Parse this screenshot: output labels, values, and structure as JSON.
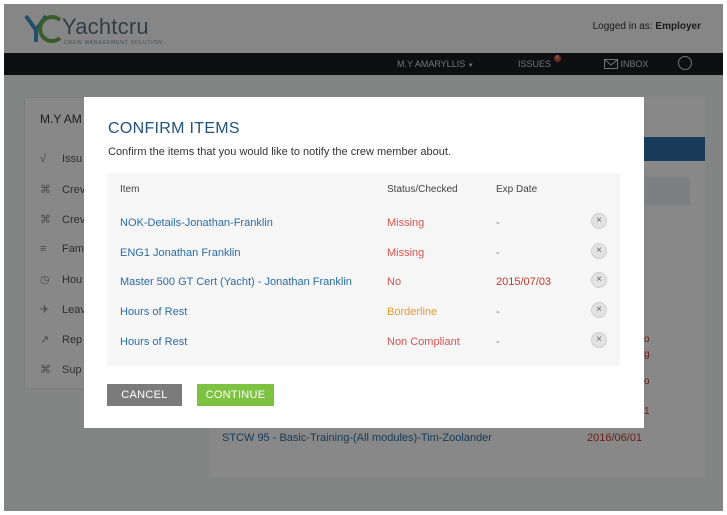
{
  "header": {
    "logo_text": "Yachtcru",
    "logo_tagline": "CREW MANAGEMENT SOLUTION",
    "logged_in_label": "Logged in as:",
    "logged_in_user": "Employer"
  },
  "navbar": {
    "vessel": "M.Y AMARYLLIS",
    "issues": "ISSUES",
    "issues_badge": "6",
    "inbox": "INBOX"
  },
  "sidebar": {
    "title": "M.Y AM",
    "items": [
      {
        "label": "Issu",
        "icon": "pen-icon"
      },
      {
        "label": "Crev",
        "icon": "crew-icon"
      },
      {
        "label": "Crev",
        "icon": "crew-group-icon"
      },
      {
        "label": "Fam",
        "icon": "list-icon"
      },
      {
        "label": "Hou",
        "icon": "clock-icon"
      },
      {
        "label": "Leav",
        "icon": "plane-icon"
      },
      {
        "label": "Rep",
        "icon": "chart-icon"
      },
      {
        "label": "Sup",
        "icon": "support-icon"
      }
    ]
  },
  "background": {
    "row_item": "STCW 95 - Basic-Training-(All modules)-Tim-Zoolander",
    "row_date": "2016/06/01",
    "fragments": [
      "o",
      "g",
      "o",
      "1"
    ]
  },
  "modal": {
    "title": "CONFIRM ITEMS",
    "subtitle": "Confirm the items that you would like to notify the crew member about.",
    "columns": [
      "Item",
      "Status/Checked",
      "Exp Date"
    ],
    "rows": [
      {
        "item": "NOK-Details-Jonathan-Franklin",
        "status": "Missing",
        "status_type": "missing",
        "exp": "-"
      },
      {
        "item": "ENG1 Jonathan Franklin",
        "status": "Missing",
        "status_type": "missing",
        "exp": "-"
      },
      {
        "item": "Master 500 GT Cert (Yacht) - Jonathan Franklin",
        "status": "No",
        "status_type": "no",
        "exp": "2015/07/03"
      },
      {
        "item": "Hours of Rest",
        "status": "Borderline",
        "status_type": "borderline",
        "exp": "-"
      },
      {
        "item": "Hours of Rest",
        "status": "Non Compliant",
        "status_type": "noncompliant",
        "exp": "-"
      }
    ],
    "remove_icon": "×",
    "cancel_label": "CANCEL",
    "continue_label": "CONTINUE"
  },
  "colors": {
    "accent_blue": "#2b6ca3",
    "title_blue": "#23527c",
    "status_red": "#d9534f",
    "status_orange": "#e69a2e",
    "continue_green": "#7ec242",
    "cancel_grey": "#7b7b7b",
    "navbar_dark": "#1b1d1e"
  }
}
